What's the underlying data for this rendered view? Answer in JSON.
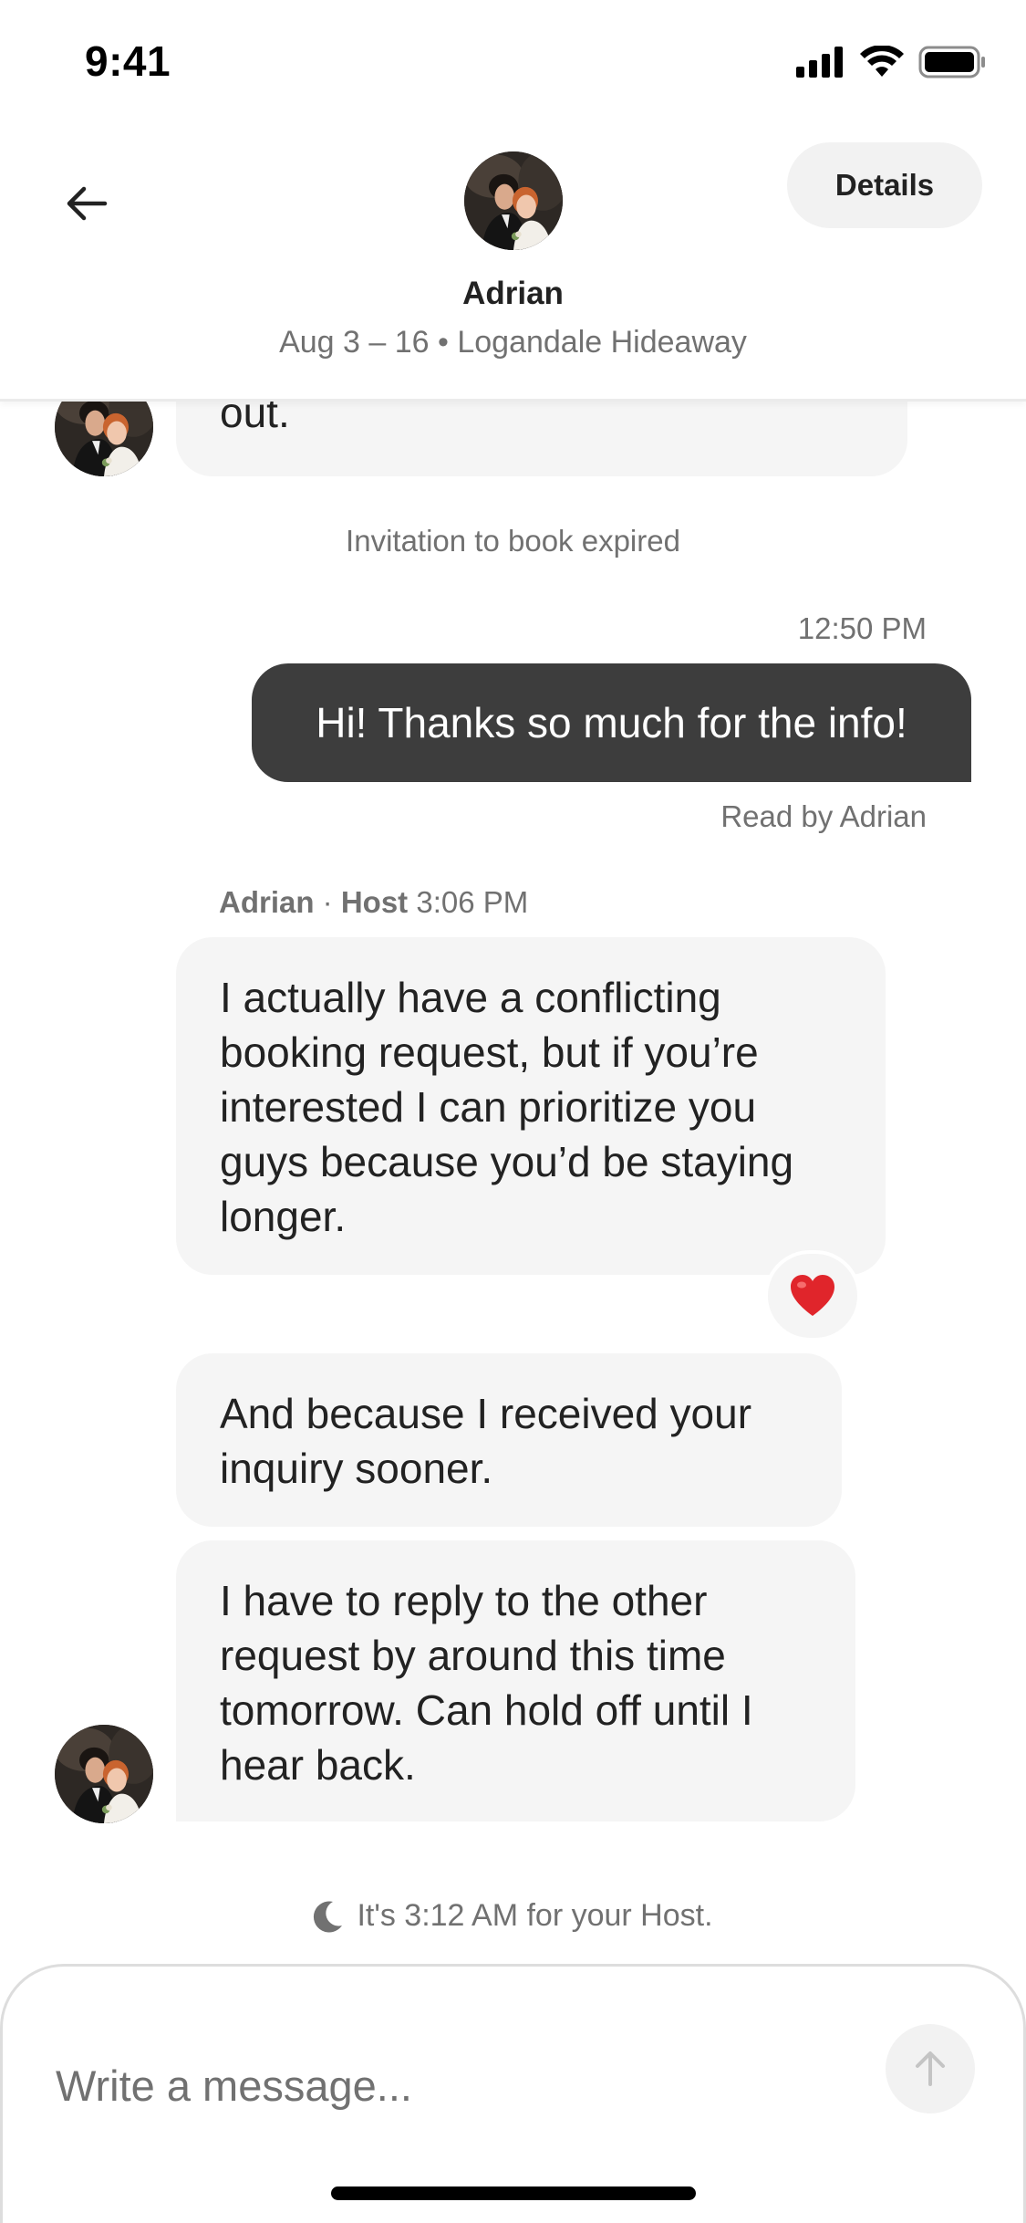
{
  "status_bar": {
    "time": "9:41"
  },
  "header": {
    "name": "Adrian",
    "subtitle": "Aug 3 – 16 • Logandale Hideaway",
    "details_label": "Details"
  },
  "thread": {
    "top_message_fragment": "out.",
    "system_note": "Invitation to book expired",
    "my_message_time": "12:50 PM",
    "my_message": "Hi! Thanks so much for the info!",
    "read_receipt": "Read by Adrian",
    "sender_name": "Adrian",
    "sender_separator": " · ",
    "sender_role": "Host",
    "sender_time": "3:06 PM",
    "host_messages": [
      {
        "lines": [
          "I actually have a conflicting",
          "booking request, but if you’re",
          "interested I can prioritize you",
          "guys because you’d be staying",
          "longer."
        ]
      },
      {
        "lines": [
          "And because I received your",
          "inquiry sooner."
        ]
      },
      {
        "lines": [
          "I have to reply to the other",
          "request by around this time",
          "tomorrow. Can hold off until I",
          "hear back."
        ]
      }
    ],
    "reaction": "❤️",
    "host_local_time_note": "It's 3:12 AM for your Host."
  },
  "composer": {
    "placeholder": "Write a message..."
  },
  "icons": {
    "back": "arrow-left-icon",
    "send": "arrow-up-icon",
    "moon": "moon-icon",
    "reaction": "heart-icon"
  }
}
